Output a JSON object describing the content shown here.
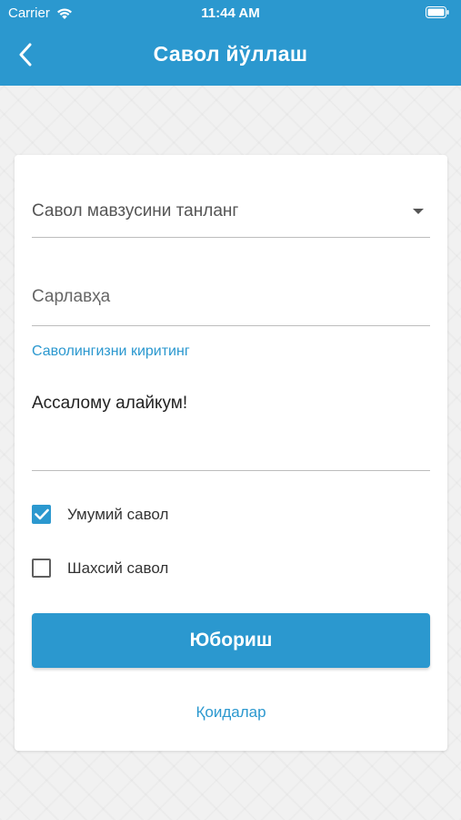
{
  "status_bar": {
    "carrier": "Carrier",
    "time": "11:44 AM"
  },
  "header": {
    "title": "Савол йўллаш",
    "back_icon": "chevron-left-icon"
  },
  "form": {
    "topic_select": {
      "placeholder": "Савол мавзусини танланг"
    },
    "title_field": {
      "placeholder": "Сарлавҳа",
      "value": ""
    },
    "question_label": "Саволингизни киритинг",
    "question_text": "Ассалому алайкум!",
    "options": [
      {
        "label": "Умумий савол",
        "checked": true
      },
      {
        "label": "Шахсий савол",
        "checked": false
      }
    ],
    "submit_label": "Юбориш",
    "rules_link": "Қоидалар"
  },
  "colors": {
    "accent": "#2b98cf",
    "background": "#f1f1f1",
    "card": "#ffffff"
  }
}
